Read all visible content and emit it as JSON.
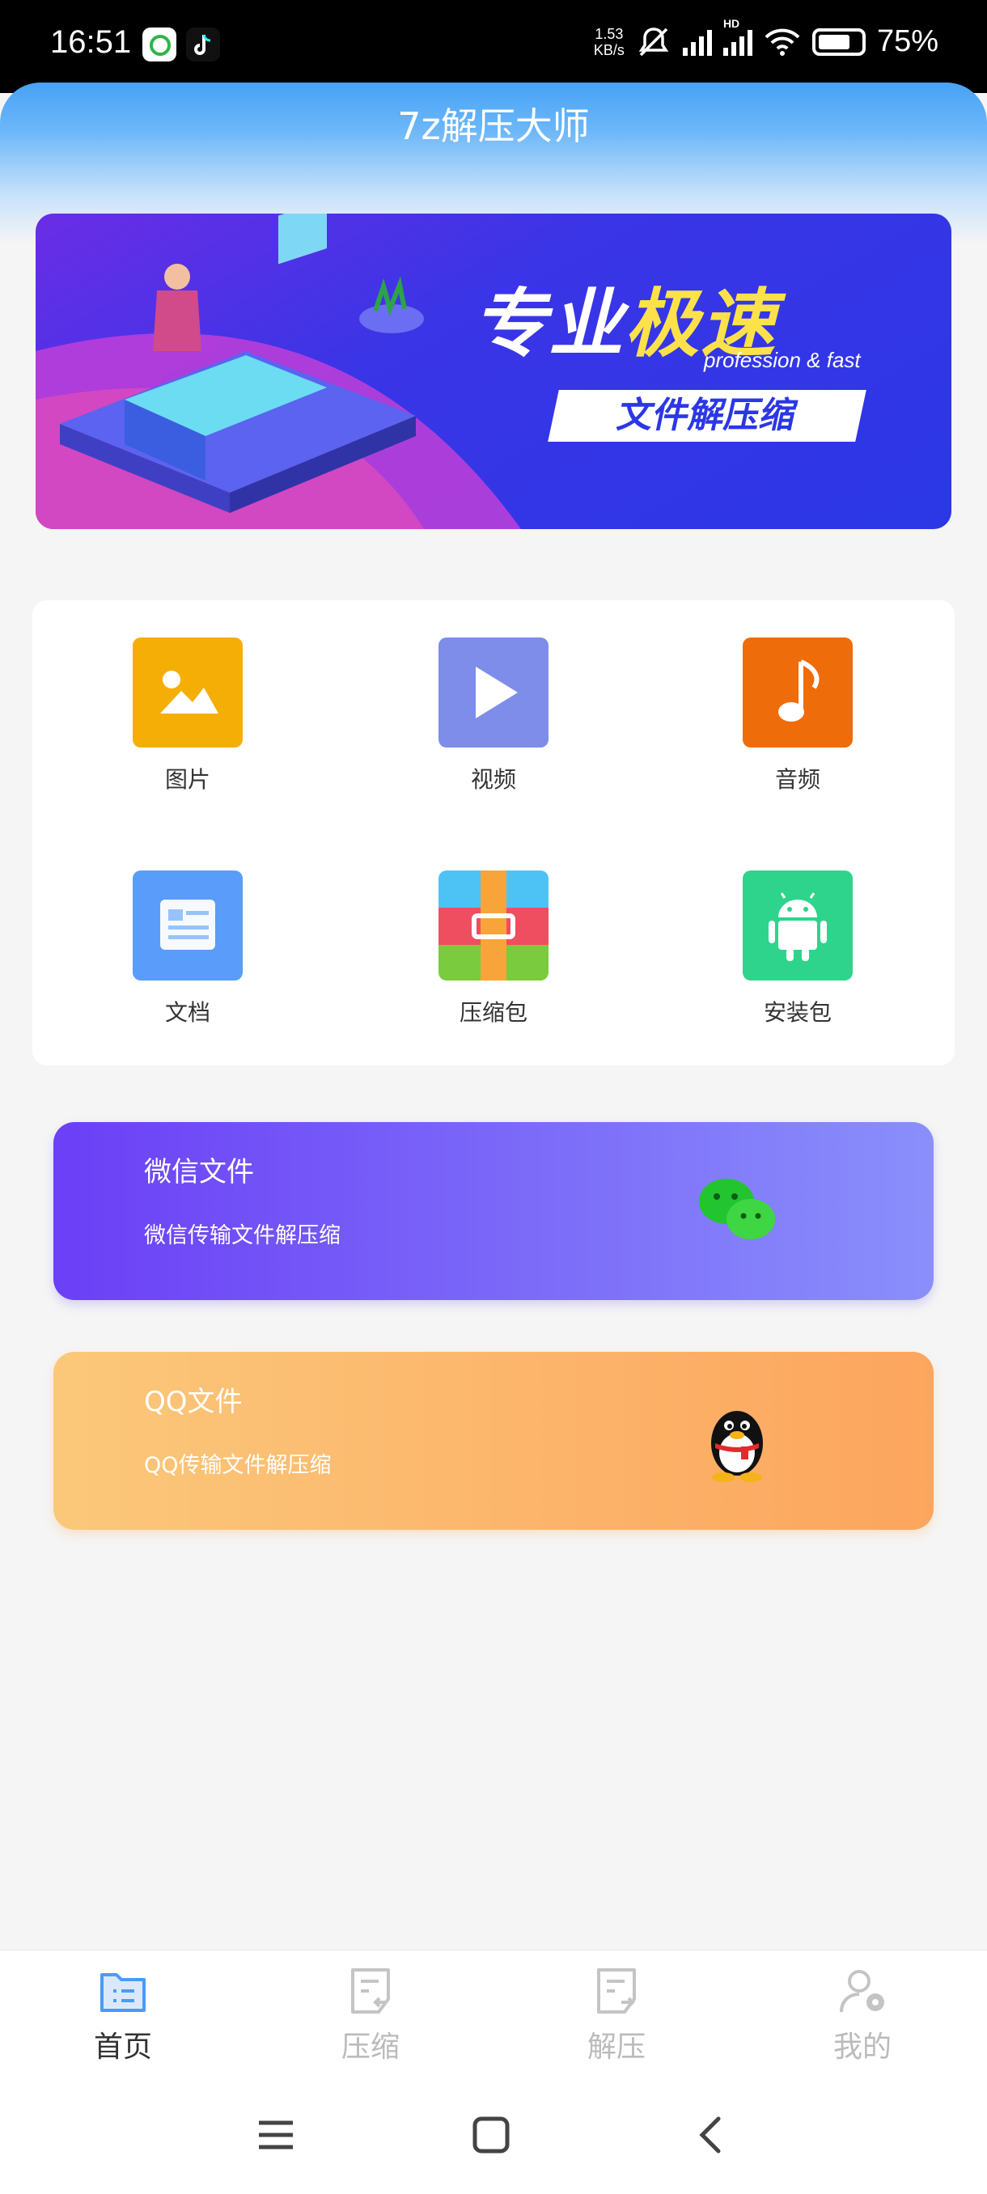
{
  "status_bar": {
    "time": "16:51",
    "net_speed_value": "1.53",
    "net_speed_unit": "KB/s",
    "network_badge": "HD",
    "battery": "75%"
  },
  "header": {
    "title": "7z解压大师"
  },
  "banner": {
    "headline_a": "专业",
    "headline_b": "极速",
    "tagline": "profession & fast",
    "subtitle": "文件解压缩"
  },
  "categories": [
    {
      "label": "图片",
      "icon": "image-icon",
      "color": "#F5AE05"
    },
    {
      "label": "视频",
      "icon": "video-icon",
      "color": "#7E8CEA"
    },
    {
      "label": "音频",
      "icon": "music-icon",
      "color": "#EE6C09"
    },
    {
      "label": "文档",
      "icon": "document-icon",
      "color": "#5A9CF9"
    },
    {
      "label": "压缩包",
      "icon": "archive-icon",
      "color": "#EF4E60"
    },
    {
      "label": "安装包",
      "icon": "android-icon",
      "color": "#2ED48C"
    }
  ],
  "promos": {
    "wechat": {
      "title": "微信文件",
      "subtitle": "微信传输文件解压缩",
      "icon": "wechat-icon"
    },
    "qq": {
      "title": "QQ文件",
      "subtitle": "QQ传输文件解压缩",
      "icon": "qq-penguin-icon"
    }
  },
  "bottom_nav": [
    {
      "label": "首页",
      "icon": "home-folder-icon",
      "active": true
    },
    {
      "label": "压缩",
      "icon": "compress-icon",
      "active": false
    },
    {
      "label": "解压",
      "icon": "extract-icon",
      "active": false
    },
    {
      "label": "我的",
      "icon": "user-settings-icon",
      "active": false
    }
  ],
  "colors": {
    "accent": "#4A9BF7",
    "wechat_start": "#6B3FF6",
    "qq_start": "#FBC87A"
  }
}
